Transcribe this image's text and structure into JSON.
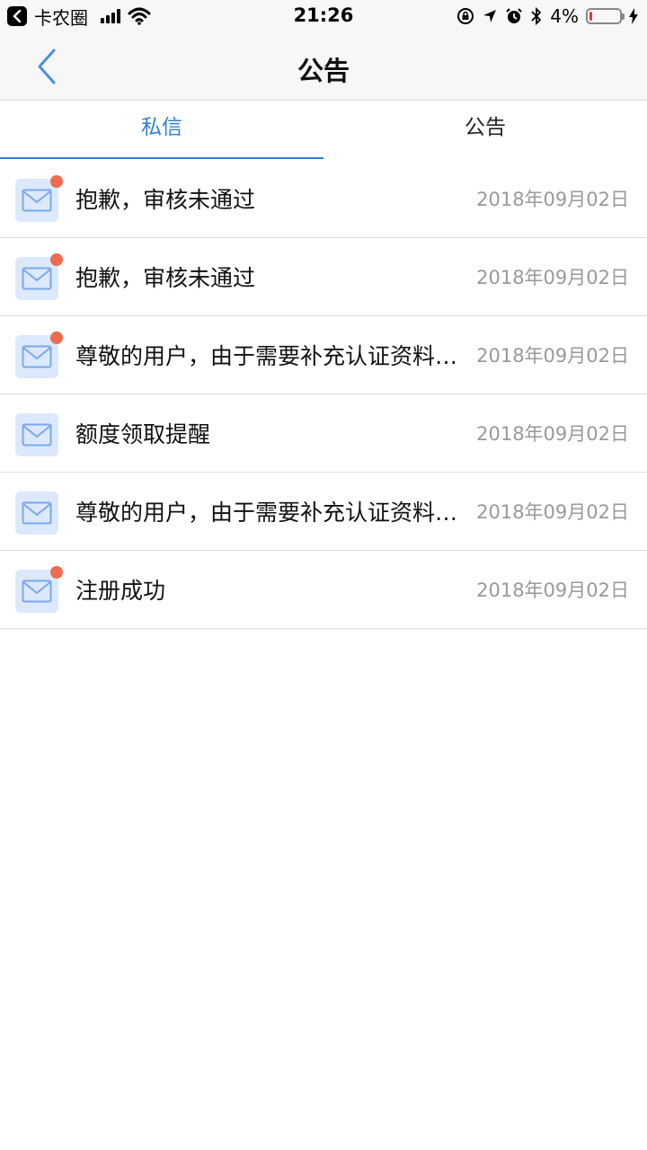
{
  "status_bar": {
    "carrier": "卡农圈",
    "time": "21:26",
    "battery": "4%",
    "battery_level": 0.04,
    "icons": [
      "back-app-icon",
      "signal-icon",
      "wifi-icon",
      "rotation-lock-icon",
      "location-icon",
      "alarm-icon",
      "bluetooth-icon",
      "battery-icon",
      "charging-icon"
    ]
  },
  "nav": {
    "title": "公告",
    "back_icon": "chevron-left-icon"
  },
  "tabs": [
    {
      "label": "私信",
      "active": true
    },
    {
      "label": "公告",
      "active": false
    }
  ],
  "colors": {
    "accent": "#2f7fd8",
    "unread_dot": "#ee6b4f",
    "icon_bg": "#dce8fb",
    "date_text": "#999999"
  },
  "messages": [
    {
      "title": "抱歉，审核未通过",
      "date": "2018年09月02日",
      "unread": true
    },
    {
      "title": "抱歉，审核未通过",
      "date": "2018年09月02日",
      "unread": true
    },
    {
      "title": "尊敬的用户，由于需要补充认证资料，您的申请暂未通过",
      "date": "2018年09月02日",
      "unread": true
    },
    {
      "title": "额度领取提醒",
      "date": "2018年09月02日",
      "unread": false
    },
    {
      "title": "尊敬的用户，由于需要补充认证资料，您的申请暂未通过",
      "date": "2018年09月02日",
      "unread": false
    },
    {
      "title": "注册成功",
      "date": "2018年09月02日",
      "unread": true
    }
  ]
}
